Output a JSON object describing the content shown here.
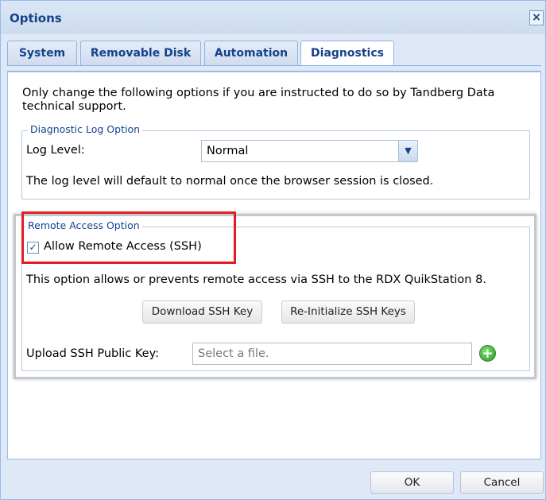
{
  "window": {
    "title": "Options",
    "close_symbol": "×"
  },
  "tabs": [
    {
      "label": "System"
    },
    {
      "label": "Removable Disk"
    },
    {
      "label": "Automation"
    },
    {
      "label": "Diagnostics"
    }
  ],
  "intro_text": "Only change the following options if you are instructed to do so by Tandberg Data technical support.",
  "diagnostic": {
    "legend": "Diagnostic Log Option",
    "log_level_label": "Log Level:",
    "log_level_value": "Normal",
    "note": "The log level will default to normal once the browser session is closed."
  },
  "remote": {
    "legend": "Remote Access Option",
    "checkbox_label": "Allow Remote Access (SSH)",
    "checkbox_checked": true,
    "description": "This option allows or prevents remote access via SSH to the RDX QuikStation 8.",
    "download_button": "Download SSH Key",
    "reinit_button": "Re-Initialize SSH Keys",
    "upload_label": "Upload SSH Public Key:",
    "upload_placeholder": "Select a file.",
    "add_symbol": "+"
  },
  "footer": {
    "ok": "OK",
    "cancel": "Cancel"
  }
}
